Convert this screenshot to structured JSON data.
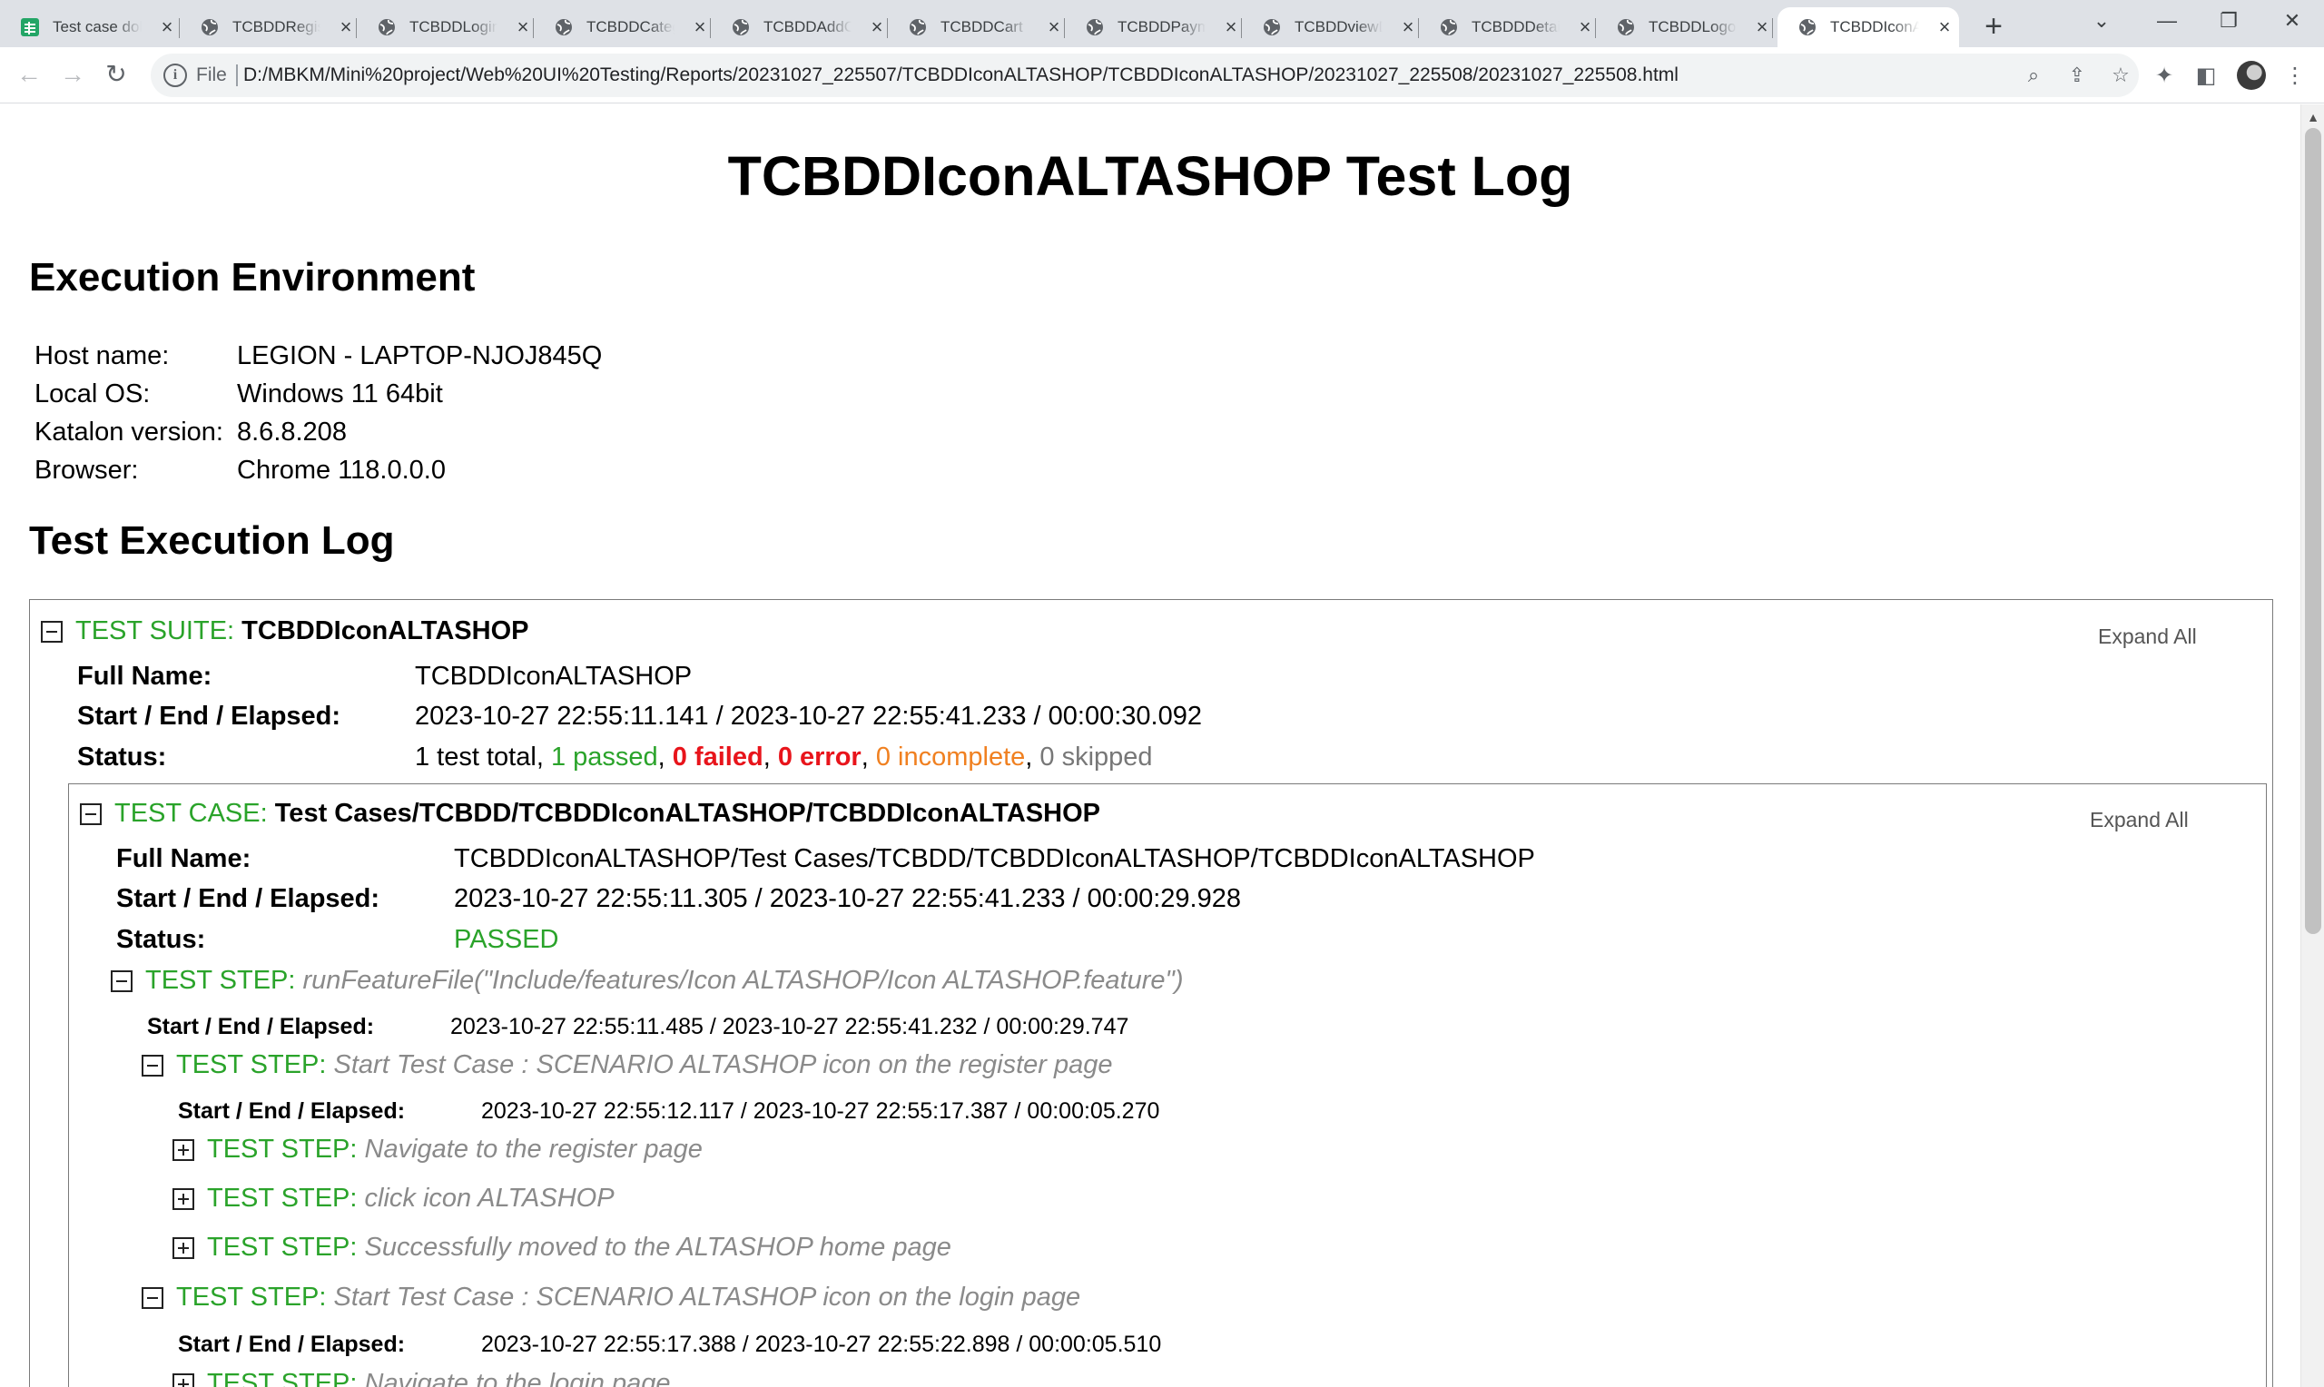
{
  "browser": {
    "tabs": [
      {
        "title": "Test case dokumentasi",
        "icon": "sheets-icon"
      },
      {
        "title": "TCBDDRegister",
        "icon": "globe-icon"
      },
      {
        "title": "TCBDDLogin",
        "icon": "globe-icon"
      },
      {
        "title": "TCBDDCategory",
        "icon": "globe-icon"
      },
      {
        "title": "TCBDDAddCart",
        "icon": "globe-icon"
      },
      {
        "title": "TCBDDCart",
        "icon": "globe-icon"
      },
      {
        "title": "TCBDDPayment",
        "icon": "globe-icon"
      },
      {
        "title": "TCBDDviewDetail",
        "icon": "globe-icon"
      },
      {
        "title": "TCBDDDetail",
        "icon": "globe-icon"
      },
      {
        "title": "TCBDDLogout",
        "icon": "globe-icon"
      },
      {
        "title": "TCBDDIconALTASHOP",
        "icon": "globe-icon",
        "active": true
      }
    ],
    "address": {
      "scheme": "File",
      "url": "D:/MBKM/Mini%20project/Web%20UI%20Testing/Reports/20231027_225507/TCBDDIconALTASHOP/TCBDDIconALTASHOP/20231027_225508/20231027_225508.html"
    }
  },
  "report": {
    "title": "TCBDDIconALTASHOP Test Log",
    "env_heading": "Execution Environment",
    "env": [
      {
        "key": "Host name:",
        "value": "LEGION - LAPTOP-NJOJ845Q"
      },
      {
        "key": "Local OS:",
        "value": "Windows 11 64bit"
      },
      {
        "key": "Katalon version:",
        "value": "8.6.8.208"
      },
      {
        "key": "Browser:",
        "value": "Chrome 118.0.0.0"
      }
    ],
    "log_heading": "Test Execution Log",
    "expand_all": "Expand All",
    "suite": {
      "label": "TEST SUITE:",
      "name": "TCBDDIconALTASHOP",
      "full_name_key": "Full Name:",
      "full_name": "TCBDDIconALTASHOP",
      "time_key": "Start / End / Elapsed:",
      "time": "2023-10-27 22:55:11.141 / 2023-10-27 22:55:41.233 / 00:00:30.092",
      "status_key": "Status:",
      "status": {
        "total": "1 test total",
        "passed": "1 passed",
        "failed": "0 failed",
        "error": "0 error",
        "incomplete": "0 incomplete",
        "skipped": "0 skipped"
      }
    },
    "case": {
      "label": "TEST CASE:",
      "name": "Test Cases/TCBDD/TCBDDIconALTASHOP/TCBDDIconALTASHOP",
      "full_name_key": "Full Name:",
      "full_name": "TCBDDIconALTASHOP/Test Cases/TCBDD/TCBDDIconALTASHOP/TCBDDIconALTASHOP",
      "time_key": "Start / End / Elapsed:",
      "time": "2023-10-27 22:55:11.305 / 2023-10-27 22:55:41.233 / 00:00:29.928",
      "status_key": "Status:",
      "status": "PASSED"
    },
    "step_label": "TEST STEP:",
    "time_key": "Start / End / Elapsed:",
    "step_root": {
      "name": "runFeatureFile(\"Include/features/Icon ALTASHOP/Icon ALTASHOP.feature\")",
      "time": "2023-10-27 22:55:11.485 / 2023-10-27 22:55:41.232 / 00:00:29.747"
    },
    "scenario1": {
      "name": "Start Test Case : SCENARIO ALTASHOP icon on the register page",
      "time": "2023-10-27 22:55:12.117 / 2023-10-27 22:55:17.387 / 00:00:05.270",
      "steps": [
        "Navigate to the register page",
        "click icon ALTASHOP",
        "Successfully moved to the ALTASHOP home page"
      ]
    },
    "scenario2": {
      "name": "Start Test Case : SCENARIO ALTASHOP icon on the login page",
      "time": "2023-10-27 22:55:17.388 / 2023-10-27 22:55:22.898 / 00:00:05.510",
      "steps": [
        "Navigate to the login page"
      ]
    }
  }
}
